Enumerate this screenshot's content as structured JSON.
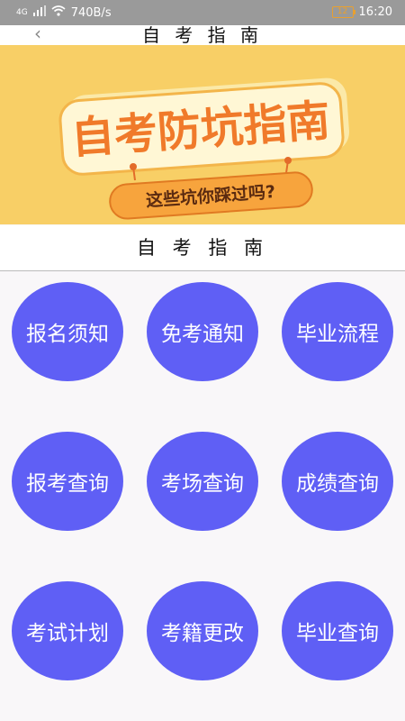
{
  "status_bar": {
    "network": "4G",
    "speed": "740B/s",
    "battery": "12",
    "time": "16:20"
  },
  "title_bar": {
    "back_icon": "chevron-left-icon",
    "title": "自 考 指 南"
  },
  "banner": {
    "headline": "自考防坑指南",
    "subline": "这些坑你踩过吗?"
  },
  "section": {
    "title": "自 考 指 南"
  },
  "menu": [
    {
      "label": "报名须知"
    },
    {
      "label": "免考通知"
    },
    {
      "label": "毕业流程"
    },
    {
      "label": "报考查询"
    },
    {
      "label": "考场查询"
    },
    {
      "label": "成绩查询"
    },
    {
      "label": "考试计划"
    },
    {
      "label": "考籍更改"
    },
    {
      "label": "毕业查询"
    }
  ],
  "colors": {
    "button_fill": "#5f5ff5",
    "banner_bg": "#f8cf66",
    "headline_orange": "#f07a2a"
  }
}
